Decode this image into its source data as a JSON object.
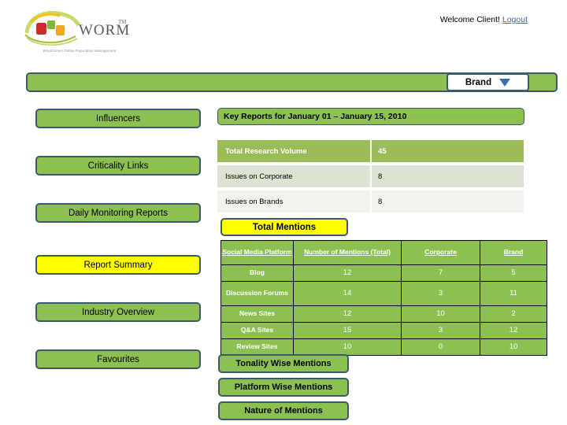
{
  "header": {
    "welcome_text": "Welcome Client!",
    "logout_label": "Logout"
  },
  "logo": {
    "wordmark": "WORM",
    "trademark": "TM",
    "tagline": "Windchimes Online Reputation Management"
  },
  "topbar": {
    "brand_select_label": "Brand",
    "caret_icon": "chevron-down-icon",
    "bar_color": "#8CC152",
    "border_color": "#3D5A6C"
  },
  "sidebar": {
    "items": [
      {
        "label": "Influencers",
        "active": false
      },
      {
        "label": "Criticality Links",
        "active": false
      },
      {
        "label": "Daily Monitoring Reports",
        "active": false
      },
      {
        "label": "Report Summary",
        "active": true
      },
      {
        "label": "Industry Overview",
        "active": false
      },
      {
        "label": "Favourites",
        "active": false
      }
    ],
    "active_color": "#FFFF00"
  },
  "main": {
    "report_title": "Key Reports for January 01 – January 15, 2010",
    "key_stats": [
      {
        "label": "Total Research Volume",
        "value": "45"
      },
      {
        "label": "Issues on Corporate",
        "value": "8"
      },
      {
        "label": "Issues on Brands",
        "value": "8"
      }
    ],
    "total_mentions_label": "Total Mentions",
    "mentions_table": {
      "columns": [
        "Social Media Platform",
        "Number of Mentions (Total)",
        "Corporate",
        "Brand"
      ],
      "rows": [
        {
          "platform": "Blog",
          "total": "12",
          "corporate": "7",
          "brand": "5"
        },
        {
          "platform": "Discussion Forums",
          "total": "14",
          "corporate": "3",
          "brand": "11"
        },
        {
          "platform": "News Sites",
          "total": "12",
          "corporate": "10",
          "brand": "2"
        },
        {
          "platform": "Q&A Sites",
          "total": "15",
          "corporate": "3",
          "brand": "12"
        },
        {
          "platform": "Review Sites",
          "total": "10",
          "corporate": "0",
          "brand": "10"
        }
      ]
    },
    "bottom_buttons": [
      "Tonality Wise Mentions",
      "Platform Wise Mentions",
      "Nature of Mentions"
    ]
  }
}
